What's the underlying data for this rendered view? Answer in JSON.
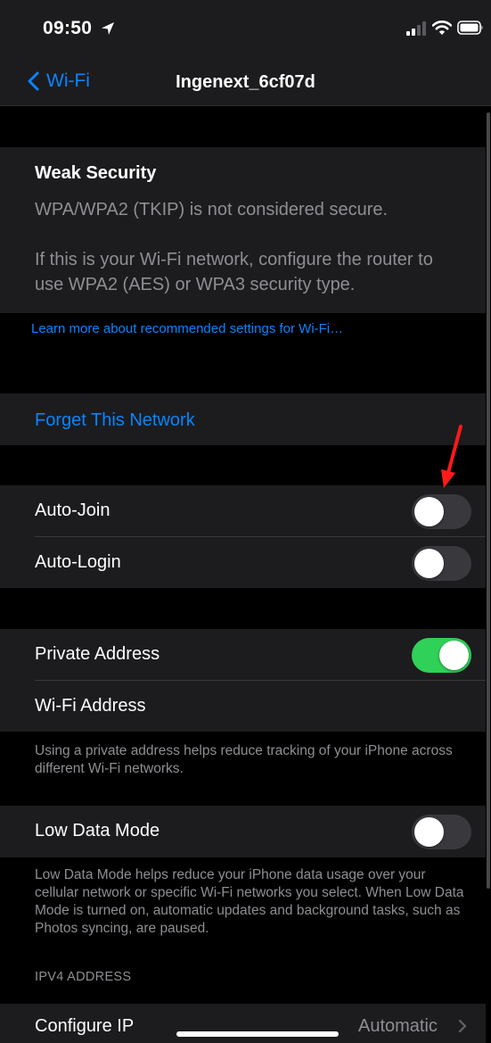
{
  "status_bar": {
    "time": "09:50",
    "icons": [
      "location-arrow-icon",
      "signal-bars-icon",
      "wifi-icon",
      "battery-icon"
    ]
  },
  "nav": {
    "back_label": "Wi-Fi",
    "back_icon": "chevron-left-icon",
    "title": "Ingenext_6cf07d"
  },
  "security_warning": {
    "title": "Weak Security",
    "line1": "WPA/WPA2 (TKIP) is not considered secure.",
    "line2": "If this is your Wi-Fi network, configure the router to use WPA2 (AES) or WPA3 security type."
  },
  "learn_more_link": "Learn more about recommended settings for Wi-Fi…",
  "forget_network": "Forget This Network",
  "join_settings": {
    "auto_join": {
      "label": "Auto-Join",
      "on": false
    },
    "auto_login": {
      "label": "Auto-Login",
      "on": false
    }
  },
  "address_settings": {
    "private_address": {
      "label": "Private Address",
      "on": true
    },
    "wifi_address": {
      "label": "Wi-Fi Address"
    },
    "footer": "Using a private address helps reduce tracking of your iPhone across different Wi-Fi networks."
  },
  "low_data": {
    "label": "Low Data Mode",
    "on": false,
    "footer": "Low Data Mode helps reduce your iPhone data usage over your cellular network or specific Wi-Fi networks you select. When Low Data Mode is turned on, automatic updates and background tasks, such as Photos syncing, are paused."
  },
  "ipv4": {
    "header": "IPV4 ADDRESS",
    "configure_ip": {
      "label": "Configure IP",
      "value": "Automatic"
    }
  },
  "colors": {
    "accent": "#0a84ff",
    "toggle_on": "#30d158",
    "toggle_off": "#39393d",
    "annotation": "#ff1a1a"
  }
}
